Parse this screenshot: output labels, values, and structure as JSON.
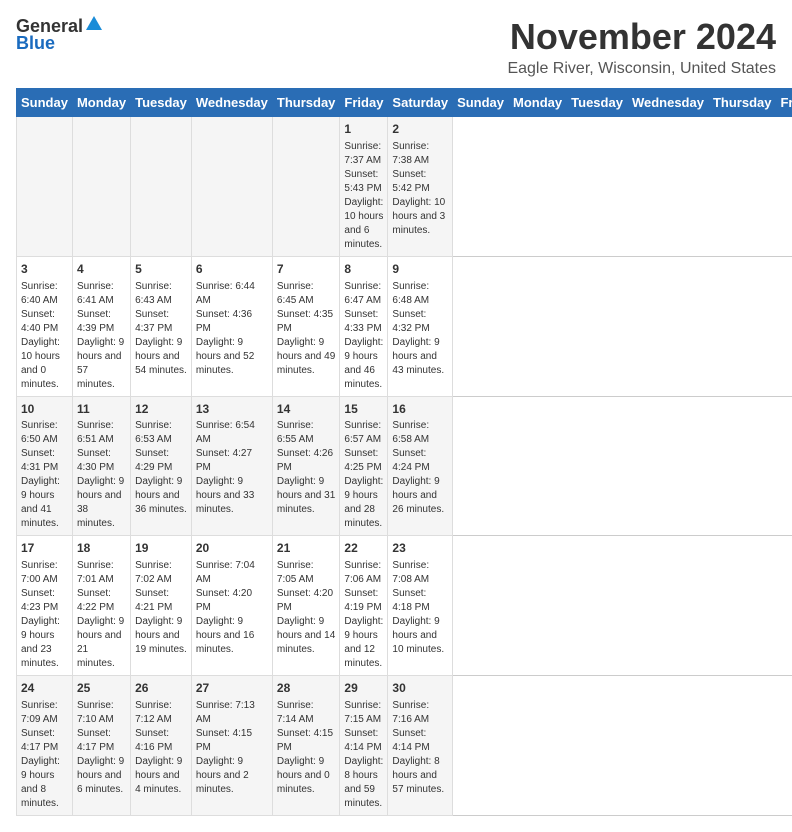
{
  "header": {
    "logo_general": "General",
    "logo_blue": "Blue",
    "month_title": "November 2024",
    "location": "Eagle River, Wisconsin, United States"
  },
  "days_of_week": [
    "Sunday",
    "Monday",
    "Tuesday",
    "Wednesday",
    "Thursday",
    "Friday",
    "Saturday"
  ],
  "weeks": [
    [
      {
        "day": "",
        "info": ""
      },
      {
        "day": "",
        "info": ""
      },
      {
        "day": "",
        "info": ""
      },
      {
        "day": "",
        "info": ""
      },
      {
        "day": "",
        "info": ""
      },
      {
        "day": "1",
        "info": "Sunrise: 7:37 AM\nSunset: 5:43 PM\nDaylight: 10 hours and 6 minutes."
      },
      {
        "day": "2",
        "info": "Sunrise: 7:38 AM\nSunset: 5:42 PM\nDaylight: 10 hours and 3 minutes."
      }
    ],
    [
      {
        "day": "3",
        "info": "Sunrise: 6:40 AM\nSunset: 4:40 PM\nDaylight: 10 hours and 0 minutes."
      },
      {
        "day": "4",
        "info": "Sunrise: 6:41 AM\nSunset: 4:39 PM\nDaylight: 9 hours and 57 minutes."
      },
      {
        "day": "5",
        "info": "Sunrise: 6:43 AM\nSunset: 4:37 PM\nDaylight: 9 hours and 54 minutes."
      },
      {
        "day": "6",
        "info": "Sunrise: 6:44 AM\nSunset: 4:36 PM\nDaylight: 9 hours and 52 minutes."
      },
      {
        "day": "7",
        "info": "Sunrise: 6:45 AM\nSunset: 4:35 PM\nDaylight: 9 hours and 49 minutes."
      },
      {
        "day": "8",
        "info": "Sunrise: 6:47 AM\nSunset: 4:33 PM\nDaylight: 9 hours and 46 minutes."
      },
      {
        "day": "9",
        "info": "Sunrise: 6:48 AM\nSunset: 4:32 PM\nDaylight: 9 hours and 43 minutes."
      }
    ],
    [
      {
        "day": "10",
        "info": "Sunrise: 6:50 AM\nSunset: 4:31 PM\nDaylight: 9 hours and 41 minutes."
      },
      {
        "day": "11",
        "info": "Sunrise: 6:51 AM\nSunset: 4:30 PM\nDaylight: 9 hours and 38 minutes."
      },
      {
        "day": "12",
        "info": "Sunrise: 6:53 AM\nSunset: 4:29 PM\nDaylight: 9 hours and 36 minutes."
      },
      {
        "day": "13",
        "info": "Sunrise: 6:54 AM\nSunset: 4:27 PM\nDaylight: 9 hours and 33 minutes."
      },
      {
        "day": "14",
        "info": "Sunrise: 6:55 AM\nSunset: 4:26 PM\nDaylight: 9 hours and 31 minutes."
      },
      {
        "day": "15",
        "info": "Sunrise: 6:57 AM\nSunset: 4:25 PM\nDaylight: 9 hours and 28 minutes."
      },
      {
        "day": "16",
        "info": "Sunrise: 6:58 AM\nSunset: 4:24 PM\nDaylight: 9 hours and 26 minutes."
      }
    ],
    [
      {
        "day": "17",
        "info": "Sunrise: 7:00 AM\nSunset: 4:23 PM\nDaylight: 9 hours and 23 minutes."
      },
      {
        "day": "18",
        "info": "Sunrise: 7:01 AM\nSunset: 4:22 PM\nDaylight: 9 hours and 21 minutes."
      },
      {
        "day": "19",
        "info": "Sunrise: 7:02 AM\nSunset: 4:21 PM\nDaylight: 9 hours and 19 minutes."
      },
      {
        "day": "20",
        "info": "Sunrise: 7:04 AM\nSunset: 4:20 PM\nDaylight: 9 hours and 16 minutes."
      },
      {
        "day": "21",
        "info": "Sunrise: 7:05 AM\nSunset: 4:20 PM\nDaylight: 9 hours and 14 minutes."
      },
      {
        "day": "22",
        "info": "Sunrise: 7:06 AM\nSunset: 4:19 PM\nDaylight: 9 hours and 12 minutes."
      },
      {
        "day": "23",
        "info": "Sunrise: 7:08 AM\nSunset: 4:18 PM\nDaylight: 9 hours and 10 minutes."
      }
    ],
    [
      {
        "day": "24",
        "info": "Sunrise: 7:09 AM\nSunset: 4:17 PM\nDaylight: 9 hours and 8 minutes."
      },
      {
        "day": "25",
        "info": "Sunrise: 7:10 AM\nSunset: 4:17 PM\nDaylight: 9 hours and 6 minutes."
      },
      {
        "day": "26",
        "info": "Sunrise: 7:12 AM\nSunset: 4:16 PM\nDaylight: 9 hours and 4 minutes."
      },
      {
        "day": "27",
        "info": "Sunrise: 7:13 AM\nSunset: 4:15 PM\nDaylight: 9 hours and 2 minutes."
      },
      {
        "day": "28",
        "info": "Sunrise: 7:14 AM\nSunset: 4:15 PM\nDaylight: 9 hours and 0 minutes."
      },
      {
        "day": "29",
        "info": "Sunrise: 7:15 AM\nSunset: 4:14 PM\nDaylight: 8 hours and 59 minutes."
      },
      {
        "day": "30",
        "info": "Sunrise: 7:16 AM\nSunset: 4:14 PM\nDaylight: 8 hours and 57 minutes."
      }
    ]
  ]
}
